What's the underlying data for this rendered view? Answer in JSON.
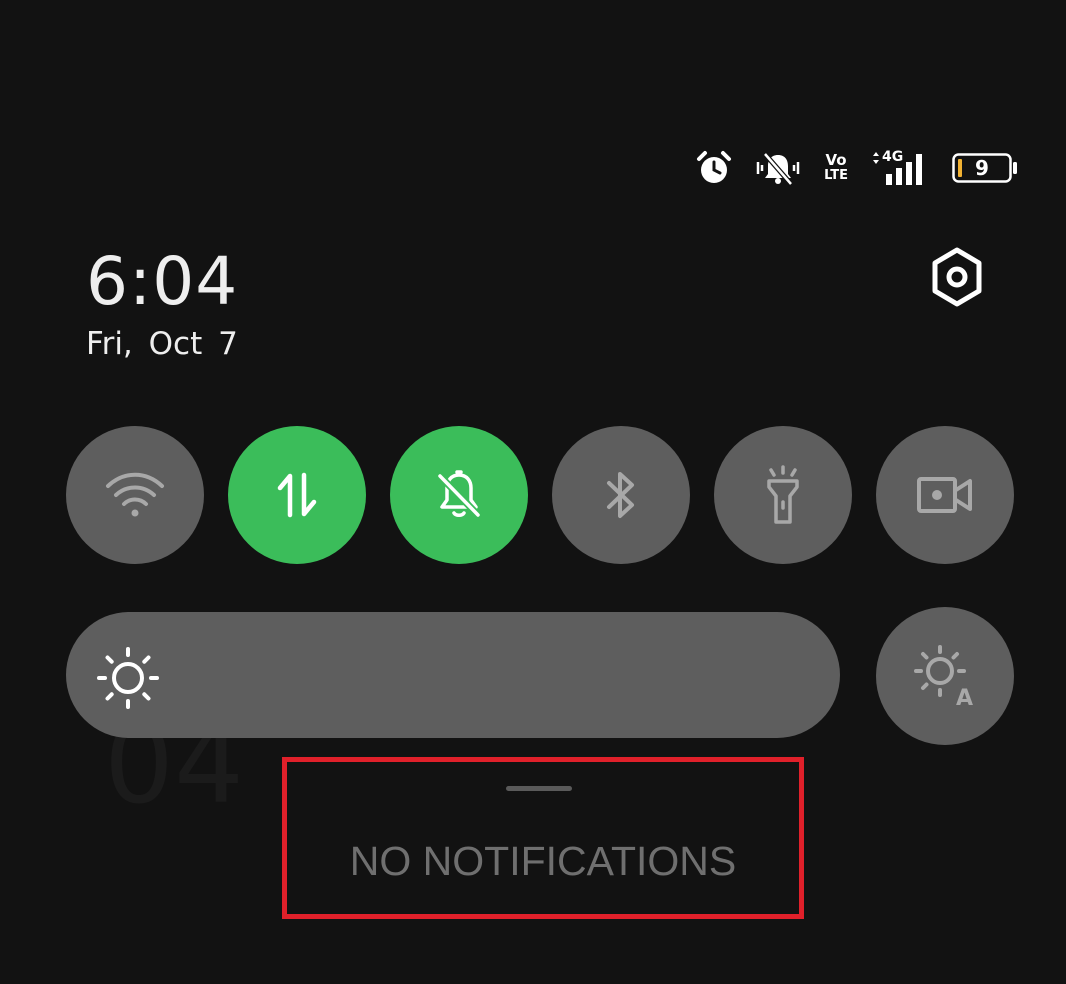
{
  "status_bar": {
    "icons": [
      "alarm-icon",
      "vibrate-silent-icon",
      "volte-icon",
      "signal-4g-icon",
      "battery-icon"
    ],
    "volte_top": "Vo",
    "volte_bottom": "LTE",
    "network_type": "4G",
    "battery_level": "9",
    "battery_color": "#f2b233"
  },
  "header": {
    "time": "6:04",
    "date": "Fri,  Oct 7",
    "settings_icon": "gear-icon"
  },
  "quick_tiles": [
    {
      "name": "wifi",
      "icon": "wifi-icon",
      "active": false
    },
    {
      "name": "mobile-data",
      "icon": "data-transfer-icon",
      "active": true
    },
    {
      "name": "do-not-disturb",
      "icon": "bell-off-icon",
      "active": true
    },
    {
      "name": "bluetooth",
      "icon": "bluetooth-icon",
      "active": false
    },
    {
      "name": "flashlight",
      "icon": "flashlight-icon",
      "active": false
    },
    {
      "name": "screen-record",
      "icon": "video-camera-icon",
      "active": false
    }
  ],
  "brightness": {
    "icon": "sun-icon",
    "auto_icon": "auto-brightness-icon",
    "auto_letter": "A"
  },
  "colors": {
    "tile_active": "#3bbd5a",
    "tile_inactive": "#5e5e5e",
    "background": "#121212",
    "highlight": "#e0202a"
  },
  "notifications": {
    "empty_label": "NO NOTIFICATIONS"
  }
}
